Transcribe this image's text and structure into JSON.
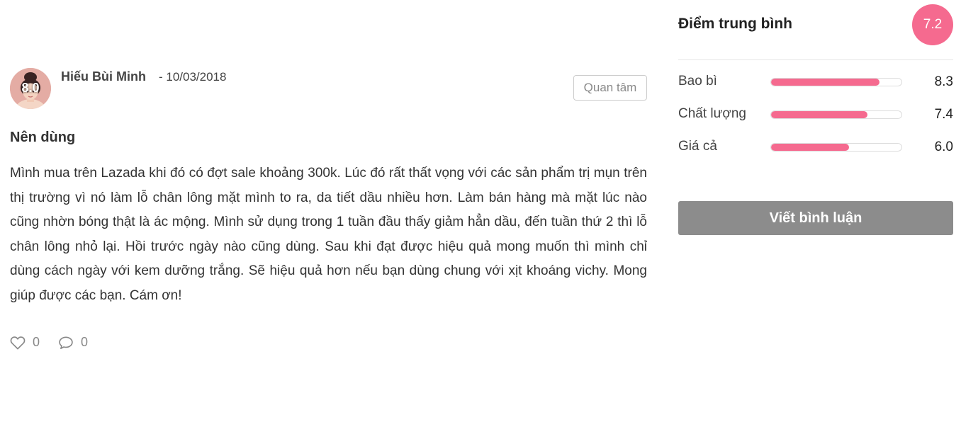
{
  "review": {
    "avatar_score": "8.0",
    "author_name": "Hiếu Bùi Minh",
    "date": "- 10/03/2018",
    "follow_label": "Quan tâm",
    "title": "Nên dùng",
    "body": "Mình mua trên Lazada khi đó có đợt sale khoảng 300k. Lúc đó rất thất vọng với các sản phẩm trị mụn trên thị trường vì nó làm lỗ chân lông mặt mình to ra, da tiết dầu nhiều hơn. Làm bán hàng mà mặt lúc nào cũng nhờn bóng thật là ác mộng. Mình sử dụng trong 1 tuần đầu thấy giảm hẳn dầu, đến tuần thứ 2 thì lỗ chân lông nhỏ lại. Hồi trước ngày nào cũng dùng. Sau khi đạt được hiệu quả mong muốn thì mình chỉ dùng cách ngày với kem dưỡng trắng. Sẽ hiệu quả hơn nếu bạn dùng chung với xịt khoáng vichy. Mong giúp được các bạn. Cám ơn!",
    "actions": {
      "like_icon": "heart-outline-icon",
      "like_count": "0",
      "comment_icon": "comment-bubble-icon",
      "comment_count": "0"
    }
  },
  "score_panel": {
    "title": "Điểm trung bình",
    "average": "7.2",
    "criteria": [
      {
        "label": "Bao bì",
        "value": "8.3",
        "fraction": 0.83
      },
      {
        "label": "Chất lượng",
        "value": "7.4",
        "fraction": 0.74
      },
      {
        "label": "Giá cả",
        "value": "6.0",
        "fraction": 0.6
      }
    ],
    "write_review_label": "Viết bình luận"
  },
  "colors": {
    "accent": "#f56a8f",
    "button_gray": "#8c8c8c",
    "text": "#333333",
    "muted": "#888888"
  }
}
